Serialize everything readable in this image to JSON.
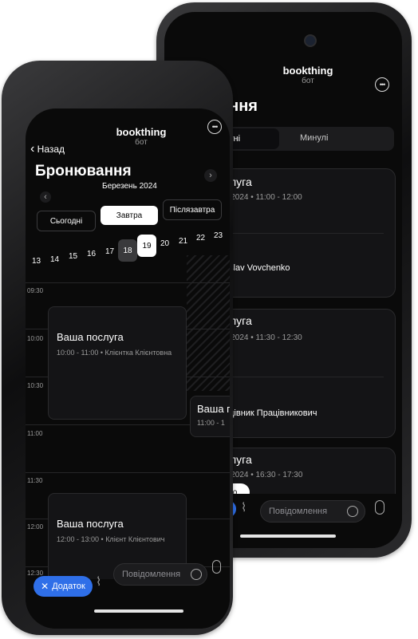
{
  "back_phone": {
    "header": {
      "title": "bookthing",
      "subtitle": "бот"
    },
    "page_title": "ання",
    "tabs": [
      {
        "label": "утні"
      },
      {
        "label": "Минулі"
      }
    ],
    "bookings": [
      {
        "service": "слуга",
        "time": "я 2024 • 11:00 - 12:00",
        "person": "oslav Vovchenko"
      },
      {
        "service": "слуга",
        "time": "я 2024 • 11:30 - 12:30",
        "person": "ацівник Працівникович"
      },
      {
        "service": "слуга",
        "time": "я 2024 • 16:30 - 17:30",
        "button": "ено"
      }
    ],
    "input_placeholder": "Повідомлення"
  },
  "front_phone": {
    "header": {
      "back": "Назад",
      "title": "bookthing",
      "subtitle": "бот"
    },
    "page_title": "Бронювання",
    "month": "Березень 2024",
    "quick_days": [
      {
        "label": "Сьогодні"
      },
      {
        "label": "Завтра"
      },
      {
        "label": "Післязавтра"
      }
    ],
    "dates": [
      {
        "day": "13"
      },
      {
        "day": "14"
      },
      {
        "day": "15"
      },
      {
        "day": "16"
      },
      {
        "day": "17"
      },
      {
        "day": "18"
      },
      {
        "day": "19"
      },
      {
        "day": "20"
      },
      {
        "day": "21"
      },
      {
        "day": "22"
      },
      {
        "day": "23"
      }
    ],
    "times": [
      {
        "label": "09:30"
      },
      {
        "label": "10:00"
      },
      {
        "label": "10:30"
      },
      {
        "label": "11:00"
      },
      {
        "label": "11:30"
      },
      {
        "label": "12:00"
      },
      {
        "label": "12:30"
      }
    ],
    "events": [
      {
        "title": "Ваша послуга",
        "detail": "10:00 - 11:00 • Клієнтка Клієнтовна"
      },
      {
        "title": "Ваша п",
        "detail": "11:00 - 1"
      },
      {
        "title": "Ваша послуга",
        "detail": "12:00 - 13:00 • Клієнт Клієнтович"
      }
    ],
    "attach_button": "Додаток",
    "input_placeholder": "Повідомлення"
  }
}
